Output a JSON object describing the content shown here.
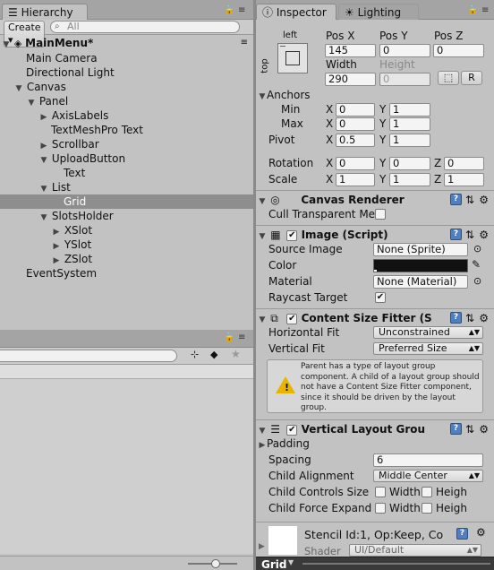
{
  "hierarchy": {
    "tab_label": "Hierarchy",
    "create_label": "Create ▾",
    "search_placeholder": "All",
    "scene_name": "MainMenu*",
    "items": [
      {
        "label": "Main Camera"
      },
      {
        "label": "Directional Light"
      },
      {
        "label": "Canvas"
      },
      {
        "label": "Panel"
      },
      {
        "label": "AxisLabels"
      },
      {
        "label": "TextMeshPro Text"
      },
      {
        "label": "Scrollbar"
      },
      {
        "label": "UploadButton"
      },
      {
        "label": "Text"
      },
      {
        "label": "List"
      },
      {
        "label": "Grid"
      },
      {
        "label": "SlotsHolder"
      },
      {
        "label": "XSlot"
      },
      {
        "label": "YSlot"
      },
      {
        "label": "ZSlot"
      },
      {
        "label": "EventSystem"
      }
    ]
  },
  "inspector": {
    "tab_label": "Inspector",
    "lighting_tab_label": "Lighting",
    "rect": {
      "anchor_preset_label": "left",
      "anchor_side_label": "top",
      "pos_x_label": "Pos X",
      "pos_y_label": "Pos Y",
      "pos_z_label": "Pos Z",
      "pos_x": "145",
      "pos_y": "0",
      "pos_z": "0",
      "width_label": "Width",
      "height_label": "Height",
      "width": "290",
      "height": "0",
      "raw_button_label": "R"
    },
    "anchors": {
      "label": "Anchors",
      "min_label": "Min",
      "max_label": "Max",
      "min_x": "0",
      "min_y": "1",
      "max_x": "0",
      "max_y": "1",
      "pivot_label": "Pivot",
      "pivot_x": "0.5",
      "pivot_y": "1"
    },
    "transform": {
      "rotation_label": "Rotation",
      "rot_x": "0",
      "rot_y": "0",
      "rot_z": "0",
      "scale_label": "Scale",
      "scale_x": "1",
      "scale_y": "1",
      "scale_z": "1",
      "x_label": "X",
      "y_label": "Y",
      "z_label": "Z"
    },
    "canvas_renderer": {
      "title": "Canvas Renderer",
      "cull_label": "Cull Transparent Me:"
    },
    "image": {
      "title": "Image (Script)",
      "source_label": "Source Image",
      "source_value": "None (Sprite)",
      "color_label": "Color",
      "color_value": "#111111",
      "material_label": "Material",
      "material_value": "None (Material)",
      "raycast_label": "Raycast Target"
    },
    "content_size_fitter": {
      "title": "Content Size Fitter (S",
      "horizontal_label": "Horizontal Fit",
      "horizontal_value": "Unconstrained",
      "vertical_label": "Vertical Fit",
      "vertical_value": "Preferred Size",
      "warning_text": "Parent has a type of layout group component. A child of a layout group should not have a Content Size Fitter component, since it should be driven by the layout group."
    },
    "vertical_layout": {
      "title": "Vertical Layout Grou",
      "padding_label": "Padding",
      "spacing_label": "Spacing",
      "spacing_value": "6",
      "alignment_label": "Child Alignment",
      "alignment_value": "Middle Center",
      "controls_label": "Child Controls Size",
      "expand_label": "Child Force Expand",
      "width_label": "Width",
      "height_label": "Heigh"
    },
    "material_preview": {
      "title": "Stencil Id:1, Op:Keep, Co",
      "shader_label": "Shader",
      "shader_value": "UI/Default"
    },
    "footer_label": "Grid"
  },
  "icons": {
    "lock": "lock-icon",
    "menu": "menu-icon",
    "help": "help-icon",
    "gear": "gear-icon",
    "settings": "settings-icon",
    "warning": "warning-icon",
    "eyedropper": "eyedropper-icon"
  },
  "colors": {
    "panel_bg": "#c2c2c2",
    "selected_row": "#8e8e8e",
    "help_blue": "#4f7fbf",
    "warning": "#e8b400"
  }
}
